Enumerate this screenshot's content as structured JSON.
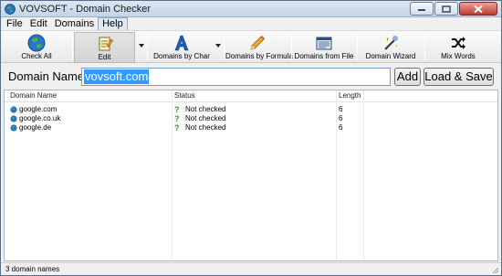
{
  "window": {
    "title": "VOVSOFT - Domain Checker"
  },
  "menu": [
    "File",
    "Edit",
    "Domains",
    "Help"
  ],
  "toolbar": {
    "check_all": "Check All",
    "edit": "Edit",
    "domains_by_char": "Domains by Char",
    "domains_by_formula": "Domains by Formula",
    "domains_from_file": "Domains from File",
    "domain_wizard": "Domain Wizard",
    "mix_words": "Mix Words"
  },
  "domain_input": {
    "label": "Domain Name:",
    "value": "vovsoft.com"
  },
  "buttons": {
    "add": "Add",
    "load_save": "Load & Save"
  },
  "list": {
    "columns": [
      "Domain Name",
      "Status",
      "Length"
    ],
    "rows": [
      {
        "domain": "google.com",
        "status": "Not checked",
        "length": "6"
      },
      {
        "domain": "google.co.uk",
        "status": "Not checked",
        "length": "6"
      },
      {
        "domain": "google.de",
        "status": "Not checked",
        "length": "6"
      }
    ]
  },
  "status_bar": {
    "text": "3 domain names"
  },
  "icons": {
    "app": "globe-icon",
    "check_all": "globe-icon",
    "edit": "edit-icon",
    "domains_by_char": "letter-a-icon",
    "domains_by_formula": "pencil-icon",
    "domains_from_file": "file-icon",
    "domain_wizard": "wand-icon",
    "mix_words": "shuffle-icon",
    "row_domain": "globe-icon",
    "row_status": "question-mark-icon"
  },
  "colors": {
    "selection": "#3399ff",
    "accent": "#2e9b2e",
    "close": "#c0392b"
  }
}
